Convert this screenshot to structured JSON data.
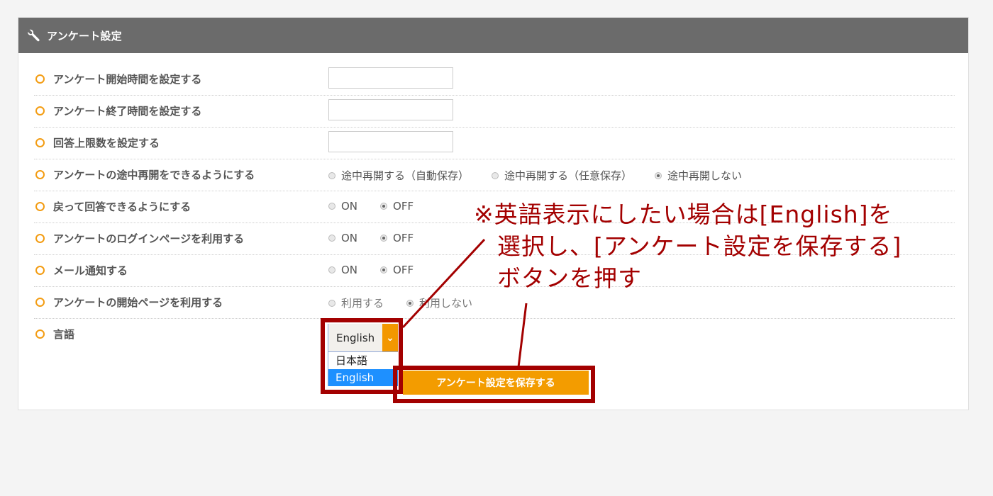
{
  "header": {
    "icon": "wrench-icon",
    "title": "アンケート設定"
  },
  "rows": [
    {
      "label": "アンケート開始時間を設定する",
      "type": "text",
      "value": ""
    },
    {
      "label": "アンケート終了時間を設定する",
      "type": "text",
      "value": ""
    },
    {
      "label": "回答上限数を設定する",
      "type": "text",
      "value": ""
    },
    {
      "label": "アンケートの途中再開をできるようにする",
      "type": "radio",
      "options": [
        "途中再開する（自動保存）",
        "途中再開する（任意保存）",
        "途中再開しない"
      ],
      "selected": 2
    },
    {
      "label": "戻って回答できるようにする",
      "type": "radio",
      "options": [
        "ON",
        "OFF"
      ],
      "selected": 1
    },
    {
      "label": "アンケートのログインページを利用する",
      "type": "radio",
      "options": [
        "ON",
        "OFF"
      ],
      "selected": 1
    },
    {
      "label": "メール通知する",
      "type": "radio",
      "options": [
        "ON",
        "OFF"
      ],
      "selected": 1
    },
    {
      "label": "アンケートの開始ページを利用する",
      "type": "radio",
      "options": [
        "利用する",
        "利用しない"
      ],
      "selected": 1,
      "disabled": true
    },
    {
      "label": "言語",
      "type": "select"
    }
  ],
  "language_select": {
    "value": "English",
    "options": [
      "日本語",
      "English"
    ],
    "highlighted": "English"
  },
  "save_button": {
    "label": "アンケート設定を保存する"
  },
  "annotation": {
    "lines": [
      "※英語表示にしたい場合は[English]を",
      "選択し、[アンケート設定を保存する]",
      "ボタンを押す"
    ],
    "color": "#a30000"
  },
  "colors": {
    "accent": "#f39c00",
    "header_bg": "#6b6b6b",
    "highlight": "#a30000",
    "selected_option": "#1e90ff"
  }
}
